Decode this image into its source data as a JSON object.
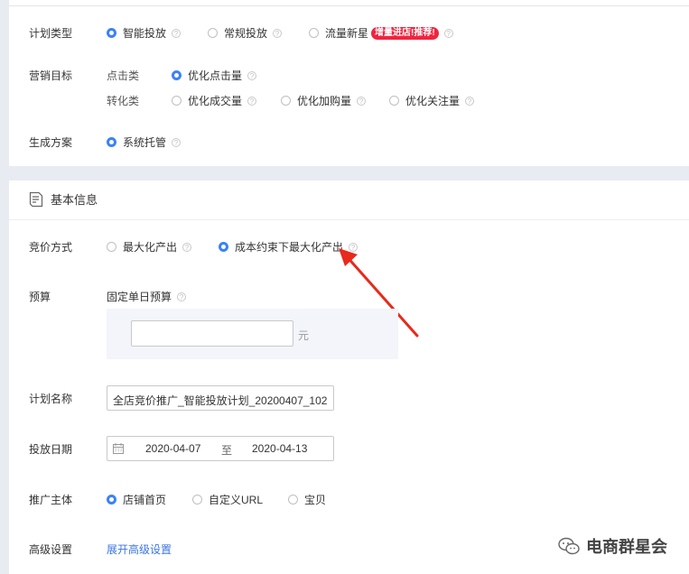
{
  "plan_type": {
    "label": "计划类型",
    "options": [
      {
        "label": "智能投放",
        "selected": true
      },
      {
        "label": "常规投放",
        "selected": false
      },
      {
        "label": "流量新星",
        "selected": false
      }
    ],
    "badge": "增量进店!推荐!"
  },
  "marketing_goal": {
    "label": "营销目标",
    "click_label": "点击类",
    "click_options": [
      {
        "label": "优化点击量",
        "selected": true
      }
    ],
    "conversion_label": "转化类",
    "conversion_options": [
      {
        "label": "优化成交量",
        "selected": false
      },
      {
        "label": "优化加购量",
        "selected": false
      },
      {
        "label": "优化关注量",
        "selected": false
      }
    ]
  },
  "scheme": {
    "label": "生成方案",
    "options": [
      {
        "label": "系统托管",
        "selected": true
      }
    ]
  },
  "basic_info": {
    "title": "基本信息"
  },
  "bidding": {
    "label": "竞价方式",
    "options": [
      {
        "label": "最大化产出",
        "selected": false
      },
      {
        "label": "成本约束下最大化产出",
        "selected": true
      }
    ]
  },
  "budget": {
    "label": "预算",
    "sub_label": "固定单日预算",
    "value": "",
    "unit": "元"
  },
  "plan_name": {
    "label": "计划名称",
    "value": "全店竞价推广_智能投放计划_20200407_102"
  },
  "dates": {
    "label": "投放日期",
    "start": "2020-04-07",
    "sep": "至",
    "end": "2020-04-13"
  },
  "promo_subject": {
    "label": "推广主体",
    "options": [
      {
        "label": "店铺首页",
        "selected": true
      },
      {
        "label": "自定义URL",
        "selected": false
      },
      {
        "label": "宝贝",
        "selected": false
      }
    ]
  },
  "advanced": {
    "label": "高级设置",
    "link": "展开高级设置"
  },
  "watermark": "电商群星会",
  "colors": {
    "accent": "#3b82f6",
    "arrow": "#e8291c",
    "badge": "#f2243f",
    "link": "#3b76e0"
  }
}
